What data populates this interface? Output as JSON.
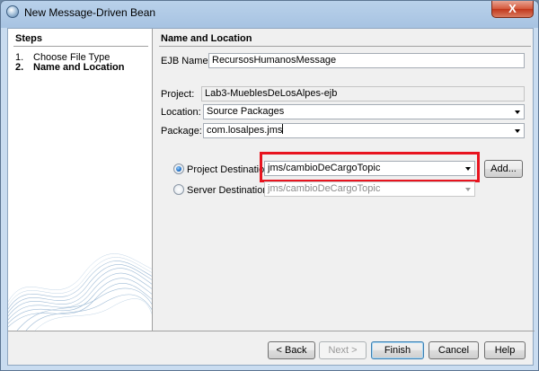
{
  "window": {
    "title": "New Message-Driven Bean",
    "close_label": "X"
  },
  "steps": {
    "header": "Steps",
    "items": [
      {
        "num": "1.",
        "label": "Choose File Type"
      },
      {
        "num": "2.",
        "label": "Name and Location"
      }
    ]
  },
  "panel": {
    "header": "Name and Location",
    "ejb_name": {
      "label": "EJB Name:",
      "value": "RecursosHumanosMessage"
    },
    "project": {
      "label": "Project:",
      "value": "Lab3-MueblesDeLosAlpes-ejb"
    },
    "location": {
      "label": "Location:",
      "value": "Source Packages"
    },
    "package": {
      "label": "Package:",
      "value": "com.losalpes.jms"
    },
    "project_destinations": {
      "label": "Project Destinations:",
      "value": "jms/cambioDeCargoTopic",
      "selected": true
    },
    "server_destinations": {
      "label": "Server Destinations:",
      "value": "jms/cambioDeCargoTopic",
      "selected": false
    },
    "add_button": "Add..."
  },
  "footer": {
    "back": "< Back",
    "next": "Next >",
    "finish": "Finish",
    "cancel": "Cancel",
    "help": "Help"
  },
  "colors": {
    "highlight": "#e8141f",
    "title_gradient": "#b9d1ea"
  }
}
